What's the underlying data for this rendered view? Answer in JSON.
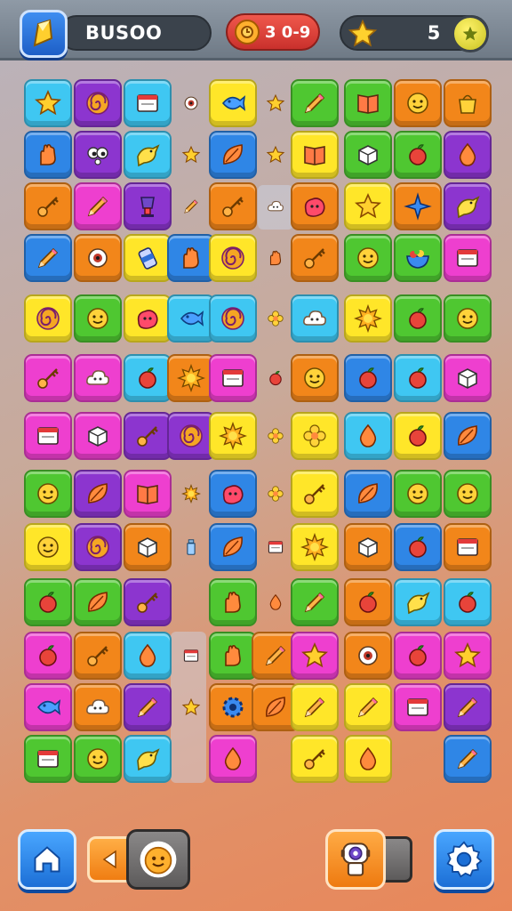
{
  "hud": {
    "score": "BUSOO",
    "timer": "3 0-9",
    "stars": "5",
    "icons": {
      "logo": "pencil-logo-icon",
      "timer": "clock-icon",
      "star": "star-icon",
      "coin": "star-coin-icon"
    }
  },
  "colors": {
    "cyan": "#3fc7f2",
    "purple": "#8c35cf",
    "blue": "#2f86e6",
    "orange": "#f2861a",
    "yellow": "#ffe629",
    "green": "#4fc731",
    "magenta": "#ee3fcf",
    "red": "#ea4a2c"
  },
  "tiles": [
    {
      "c": "cyan",
      "i": "star"
    },
    {
      "c": "purple",
      "i": "swirl"
    },
    {
      "c": "cyan",
      "i": "card"
    },
    {
      "c": "small",
      "i": "eye"
    },
    {
      "c": "yellow",
      "i": "fish"
    },
    {
      "c": "small",
      "i": "star"
    },
    {
      "c": "green",
      "i": "pencil"
    },
    {
      "c": "green",
      "i": "book"
    },
    {
      "c": "orange",
      "i": "face"
    },
    {
      "c": "orange",
      "i": "bag"
    },
    {
      "c": "blue",
      "i": "hand"
    },
    {
      "c": "purple",
      "i": "eyes"
    },
    {
      "c": "cyan",
      "i": "bird"
    },
    {
      "c": "small",
      "i": "star"
    },
    {
      "c": "blue",
      "i": "leaf"
    },
    {
      "c": "small",
      "i": "star"
    },
    {
      "c": "yellow",
      "i": "book"
    },
    {
      "c": "green",
      "i": "box"
    },
    {
      "c": "green",
      "i": "fruit"
    },
    {
      "c": "purple",
      "i": "drop"
    },
    {
      "c": "orange",
      "i": "key"
    },
    {
      "c": "magenta",
      "i": "pencil"
    },
    {
      "c": "purple",
      "i": "lamp"
    },
    {
      "c": "small",
      "i": "pencil"
    },
    {
      "c": "orange",
      "i": "key"
    },
    {
      "c": "small",
      "i": "cloud"
    },
    {
      "c": "orange",
      "i": "blob"
    },
    {
      "c": "yellow",
      "i": "star"
    },
    {
      "c": "orange",
      "i": "diamond"
    },
    {
      "c": "purple",
      "i": "bird"
    },
    {
      "c": "blue",
      "i": "pencil"
    },
    {
      "c": "orange",
      "i": "eye"
    },
    {
      "c": "yellow",
      "i": "can"
    },
    {
      "c": "blue",
      "i": "hand"
    },
    {
      "c": "yellow",
      "i": "swirl"
    },
    {
      "c": "small",
      "i": "hand"
    },
    {
      "c": "orange",
      "i": "key"
    },
    {
      "c": "green",
      "i": "face"
    },
    {
      "c": "green",
      "i": "bowl"
    },
    {
      "c": "magenta",
      "i": "card"
    },
    {
      "c": "yellow",
      "i": "swirl"
    },
    {
      "c": "green",
      "i": "face"
    },
    {
      "c": "yellow",
      "i": "blob"
    },
    {
      "c": "cyan",
      "i": "fish"
    },
    {
      "c": "cyan",
      "i": "swirl"
    },
    {
      "c": "small",
      "i": "flower"
    },
    {
      "c": "cyan",
      "i": "cloud"
    },
    {
      "c": "yellow",
      "i": "sun"
    },
    {
      "c": "green",
      "i": "fruit"
    },
    {
      "c": "green",
      "i": "face"
    },
    {
      "c": "magenta",
      "i": "key"
    },
    {
      "c": "magenta",
      "i": "cloud"
    },
    {
      "c": "cyan",
      "i": "fruit"
    },
    {
      "c": "orange",
      "i": "sun"
    },
    {
      "c": "magenta",
      "i": "card"
    },
    {
      "c": "small",
      "i": "fruit"
    },
    {
      "c": "orange",
      "i": "face"
    },
    {
      "c": "blue",
      "i": "fruit"
    },
    {
      "c": "cyan",
      "i": "fruit"
    },
    {
      "c": "magenta",
      "i": "box"
    },
    {
      "c": "magenta",
      "i": "card"
    },
    {
      "c": "magenta",
      "i": "box"
    },
    {
      "c": "purple",
      "i": "key"
    },
    {
      "c": "purple",
      "i": "swirl"
    },
    {
      "c": "yellow",
      "i": "sun"
    },
    {
      "c": "small",
      "i": "flower"
    },
    {
      "c": "yellow",
      "i": "flower"
    },
    {
      "c": "cyan",
      "i": "drop"
    },
    {
      "c": "yellow",
      "i": "fruit"
    },
    {
      "c": "blue",
      "i": "leaf"
    },
    {
      "c": "green",
      "i": "face"
    },
    {
      "c": "purple",
      "i": "leaf"
    },
    {
      "c": "magenta",
      "i": "book"
    },
    {
      "c": "small",
      "i": "sun"
    },
    {
      "c": "blue",
      "i": "blob"
    },
    {
      "c": "small",
      "i": "flower"
    },
    {
      "c": "yellow",
      "i": "key"
    },
    {
      "c": "blue",
      "i": "leaf"
    },
    {
      "c": "green",
      "i": "face"
    },
    {
      "c": "green",
      "i": "face"
    },
    {
      "c": "yellow",
      "i": "face"
    },
    {
      "c": "purple",
      "i": "swirl"
    },
    {
      "c": "orange",
      "i": "box"
    },
    {
      "c": "small",
      "i": "bottle"
    },
    {
      "c": "blue",
      "i": "leaf"
    },
    {
      "c": "small",
      "i": "card"
    },
    {
      "c": "yellow",
      "i": "sun"
    },
    {
      "c": "orange",
      "i": "box"
    },
    {
      "c": "blue",
      "i": "fruit"
    },
    {
      "c": "orange",
      "i": "card"
    },
    {
      "c": "green",
      "i": "fruit"
    },
    {
      "c": "green",
      "i": "leaf"
    },
    {
      "c": "purple",
      "i": "key"
    },
    {
      "c": "green",
      "i": "hand"
    },
    {
      "c": "small",
      "i": "drop"
    },
    {
      "c": "green",
      "i": "pencil"
    },
    {
      "c": "orange",
      "i": "fruit"
    },
    {
      "c": "cyan",
      "i": "bird"
    },
    {
      "c": "cyan",
      "i": "fruit"
    },
    {
      "c": "magenta",
      "i": "fruit"
    },
    {
      "c": "orange",
      "i": "key"
    },
    {
      "c": "cyan",
      "i": "drop"
    },
    {
      "c": "small",
      "i": "card"
    },
    {
      "c": "green",
      "i": "hand"
    },
    {
      "c": "orange",
      "i": "pencil"
    },
    {
      "c": "magenta",
      "i": "star"
    },
    {
      "c": "orange",
      "i": "eye"
    },
    {
      "c": "magenta",
      "i": "fruit"
    },
    {
      "c": "magenta",
      "i": "star"
    },
    {
      "c": "magenta",
      "i": "fish"
    },
    {
      "c": "orange",
      "i": "cloud"
    },
    {
      "c": "purple",
      "i": "pencil"
    },
    {
      "c": "small",
      "i": "star"
    },
    {
      "c": "orange",
      "i": "gear"
    },
    {
      "c": "orange",
      "i": "leaf"
    },
    {
      "c": "yellow",
      "i": "pencil"
    },
    {
      "c": "yellow",
      "i": "pencil"
    },
    {
      "c": "magenta",
      "i": "card"
    },
    {
      "c": "purple",
      "i": "pencil"
    },
    {
      "c": "green",
      "i": "card"
    },
    {
      "c": "green",
      "i": "face"
    },
    {
      "c": "cyan",
      "i": "bird"
    },
    {
      "c": "magenta",
      "i": "drop"
    },
    {
      "c": "yellow",
      "i": "key"
    },
    {
      "c": "yellow",
      "i": "drop"
    },
    {
      "c": "blue",
      "i": "pencil"
    }
  ],
  "footer": {
    "home": "home-icon",
    "back": "arrow-left-icon",
    "face": "smiley-icon",
    "robot": "robot-icon",
    "settings": "gear-icon"
  }
}
